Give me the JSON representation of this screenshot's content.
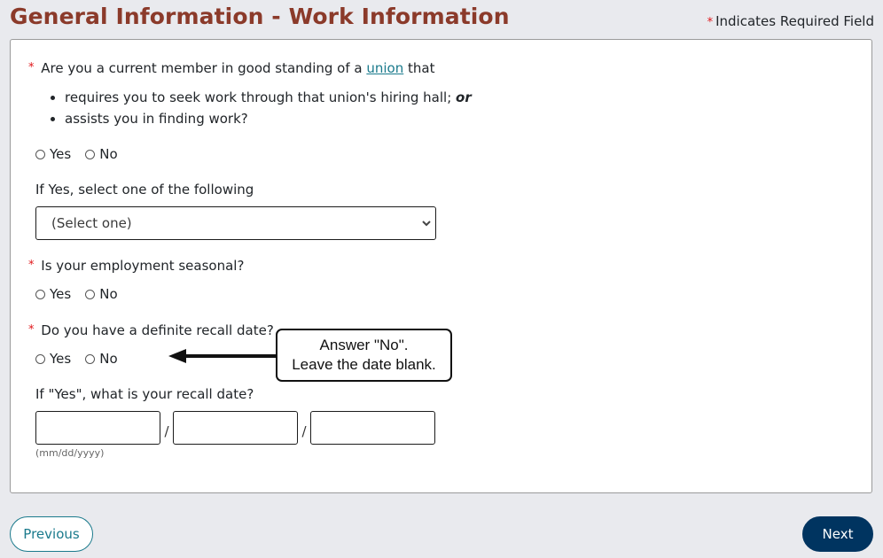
{
  "header": {
    "title": "General Information - Work Information",
    "required_star": "*",
    "required_note": "Indicates Required Field"
  },
  "colors": {
    "title": "#8b3a2a",
    "required_star": "#e0161a",
    "link": "#1a7a8c",
    "next_button_bg": "#003460",
    "page_bg": "#e9eaee"
  },
  "form": {
    "union_question": {
      "star": "*",
      "prefix": "Are you a current member in good standing of a",
      "link_text": "union",
      "suffix": "that",
      "bullets": [
        {
          "text": "requires you to seek work through that union's hiring hall;",
          "emphasis": "or"
        },
        {
          "text": "assists you in finding work?"
        }
      ],
      "options": [
        "Yes",
        "No"
      ],
      "selected": null
    },
    "union_type": {
      "label": "If Yes, select one of the following",
      "selected_value": "(Select one)"
    },
    "seasonal_question": {
      "star": "*",
      "label": "Is your employment seasonal?",
      "options": [
        "Yes",
        "No"
      ],
      "selected": null
    },
    "recall_question": {
      "star": "*",
      "label": "Do you have a definite recall date?",
      "options": [
        "Yes",
        "No"
      ],
      "selected": null
    },
    "recall_date": {
      "label": "If \"Yes\", what is your recall date?",
      "month": "",
      "day": "",
      "year": "",
      "separator": "/",
      "format_hint": "(mm/dd/yyyy)"
    }
  },
  "callout": {
    "line1": "Answer \"No\".",
    "line2": "Leave the date blank."
  },
  "footer": {
    "previous_label": "Previous",
    "next_label": "Next"
  }
}
